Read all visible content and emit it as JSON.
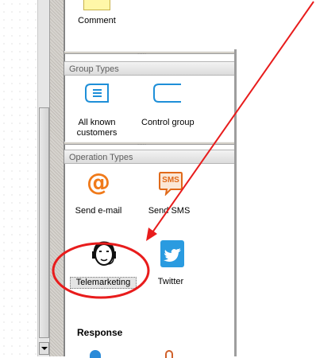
{
  "palette": {
    "items": {
      "comment": "Comment",
      "all_known_customers": "All known customers",
      "control_group": "Control group",
      "send_email": "Send e-mail",
      "send_sms": "Send SMS",
      "sms_badge": "SMS",
      "telemarketing": "Telemarketing",
      "twitter": "Twitter"
    },
    "sections": {
      "group_types": "Group Types",
      "operation_types": "Operation Types",
      "response": "Response"
    },
    "grip_dots": "....."
  },
  "colors": {
    "email_orange": "#f07a1a",
    "sms_orange": "#e06a1a",
    "group_blue": "#1e8fd8",
    "twitter_blue": "#2a9be0",
    "annotation_red": "#e81c1c"
  }
}
